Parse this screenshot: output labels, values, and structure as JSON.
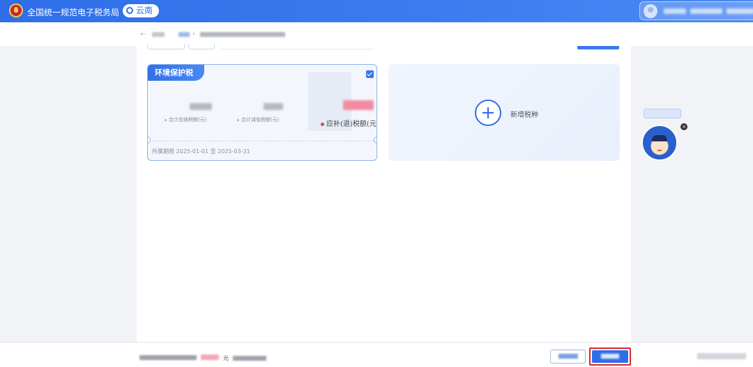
{
  "header": {
    "site_title": "全国统一规范电子税务局",
    "region": "云南"
  },
  "tax_card": {
    "tag": "环境保护税",
    "metrics": [
      {
        "label": "合计应纳税额(元)"
      },
      {
        "label": "合计减免税额(元)"
      },
      {
        "label": "应补(退)税额(元)"
      }
    ],
    "period": "所属期限 2025-01-01 至 2025-03-31"
  },
  "add_card": {
    "label": "新增税种"
  },
  "footer": {
    "unit_note": "元"
  },
  "colors": {
    "brand_blue": "#2f6ee8",
    "highlight_red": "#d8262b",
    "card_border": "#8fb1e6"
  },
  "icons": {
    "emblem": "national-emblem-icon",
    "location": "location-pin-icon",
    "add": "plus-circle-icon",
    "check": "checkbox-checked-icon",
    "assistant": "assistant-avatar-icon"
  }
}
